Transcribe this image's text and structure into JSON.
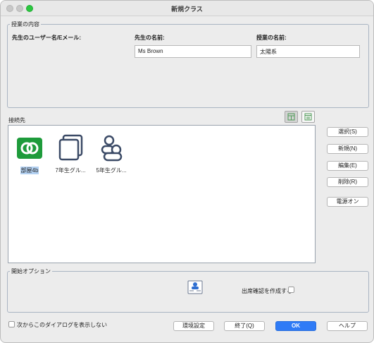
{
  "window": {
    "title": "新規クラス"
  },
  "lesson_group": {
    "legend": "授業の内容",
    "teacher_user_label": "先生のユーザー名/Eメール:",
    "teacher_name_label": "先生の名前:",
    "teacher_name_value": "Ms Brown",
    "lesson_name_label": "授業の名前:",
    "lesson_name_value": "太陽系"
  },
  "connections": {
    "label": "接続先",
    "items": [
      {
        "label": "部屋4b",
        "icon": "room-icon",
        "selected": true
      },
      {
        "label": "7年生グル...",
        "icon": "devices-icon",
        "selected": false
      },
      {
        "label": "5年生グル...",
        "icon": "students-icon",
        "selected": false
      }
    ]
  },
  "side_buttons": {
    "select": "選択(S)",
    "new": "新規(N)",
    "edit": "編集(E)",
    "delete": "削除(R)",
    "power_on": "電源オン"
  },
  "start_options": {
    "legend": "開始オプション",
    "attendance_label": "出席確認を作成する",
    "attendance_checked": false
  },
  "footer": {
    "dont_show_label": "次からこのダイアログを表示しない",
    "dont_show_checked": false,
    "settings": "環境設定",
    "finish": "終了(Q)",
    "ok": "OK",
    "help": "ヘルプ"
  },
  "colors": {
    "accent": "#2f7bf6",
    "room_icon_green": "#1e9b3b",
    "icon_navy": "#3b4a66",
    "selection": "#b3d1f2"
  }
}
